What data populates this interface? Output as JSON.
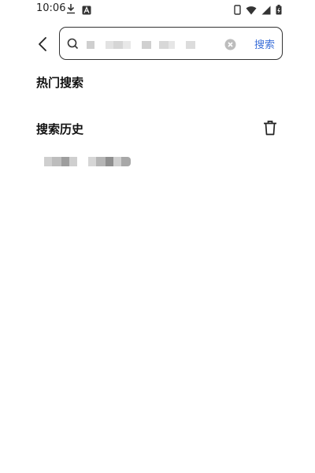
{
  "status_bar": {
    "time": "10:06",
    "icons": [
      "download-icon",
      "a-notification-icon",
      "phone-outline-icon",
      "wifi-icon",
      "signal-icon",
      "battery-icon"
    ]
  },
  "search": {
    "placeholder": "",
    "submit_label": "搜索",
    "back_icon": "chevron-left-icon",
    "search_icon": "search-icon",
    "clear_icon": "clear-circle-icon"
  },
  "sections": {
    "hot_title": "热门搜索",
    "history_title": "搜索历史",
    "delete_icon": "trash-icon"
  },
  "colors": {
    "accent": "#3b6fd8",
    "text": "#111111"
  }
}
